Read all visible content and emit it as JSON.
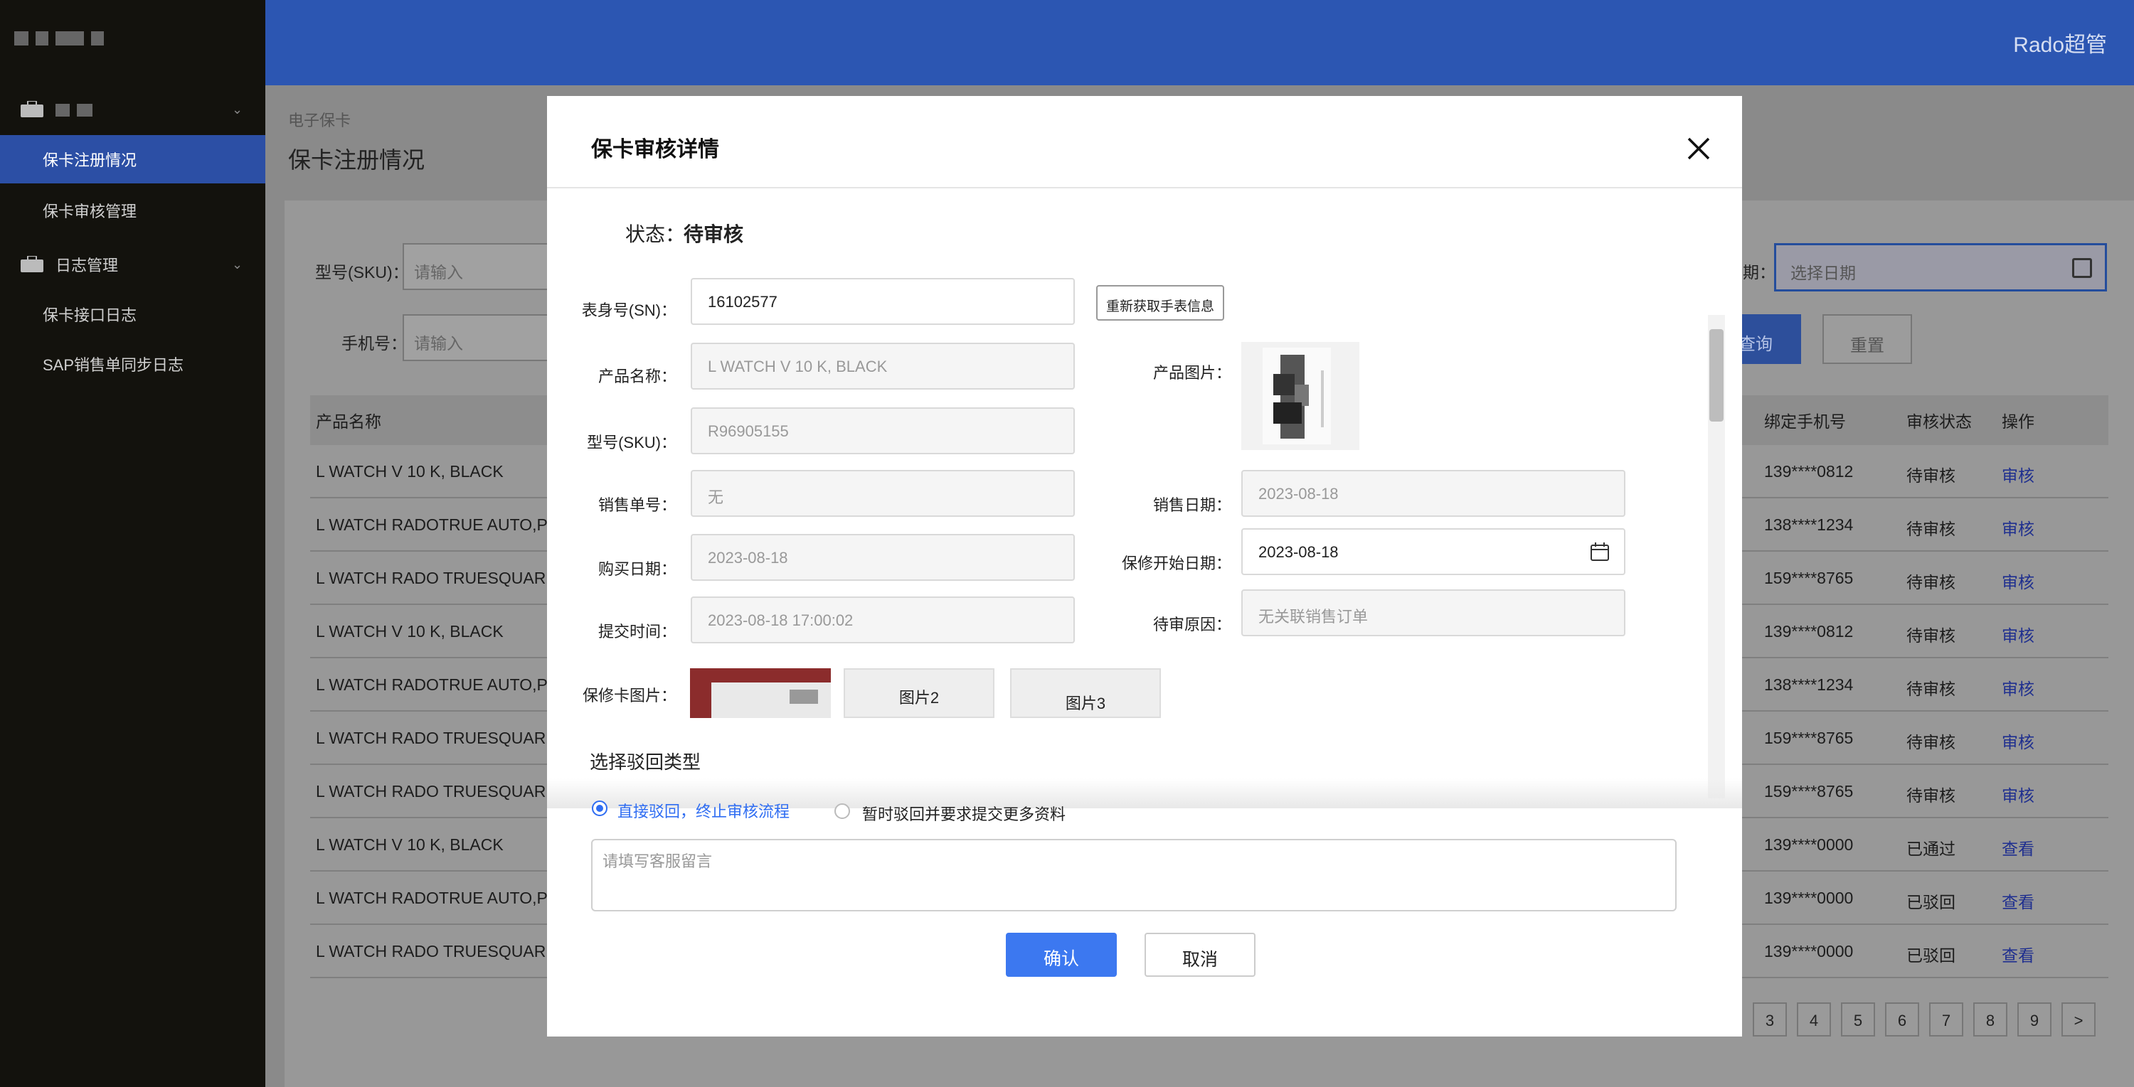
{
  "sidebar": {
    "groups": [
      {
        "label": ""
      },
      {
        "label": "日志管理"
      }
    ],
    "items": [
      {
        "label": "保卡注册情况"
      },
      {
        "label": "保卡审核管理"
      },
      {
        "label": "保卡接口日志"
      },
      {
        "label": "SAP销售单同步日志"
      }
    ]
  },
  "header": {
    "user": "Rado超管"
  },
  "breadcrumb": "电子保卡",
  "page_title": "保卡注册情况",
  "filters": {
    "sku_label": "型号(SKU)：",
    "sku_placeholder": "请输入",
    "phone_label": "手机号：",
    "phone_placeholder": "请输入",
    "date_label_tail": "期：",
    "date_placeholder": "选择日期",
    "query": "查询",
    "reset": "重置"
  },
  "table": {
    "headers": {
      "product": "产品名称",
      "phone": "绑定手机号",
      "status": "审核状态",
      "action": "操作"
    },
    "rows": [
      {
        "product": "L WATCH V 10 K, BLACK",
        "phone": "139****0812",
        "status": "待审核",
        "action": "审核"
      },
      {
        "product": "L WATCH RADOTRUE AUTO,PLA",
        "phone": "138****1234",
        "status": "待审核",
        "action": "审核"
      },
      {
        "product": "L WATCH RADO TRUESQUARE B",
        "phone": "159****8765",
        "status": "待审核",
        "action": "审核"
      },
      {
        "product": "L WATCH V 10 K, BLACK",
        "phone": "139****0812",
        "status": "待审核",
        "action": "审核"
      },
      {
        "product": "L WATCH RADOTRUE AUTO,PLA",
        "phone": "138****1234",
        "status": "待审核",
        "action": "审核"
      },
      {
        "product": "L WATCH RADO TRUESQUARE B",
        "phone": "159****8765",
        "status": "待审核",
        "action": "审核"
      },
      {
        "product": "L WATCH RADO TRUESQUARE B",
        "phone": "159****8765",
        "status": "待审核",
        "action": "审核"
      },
      {
        "product": "L WATCH V 10 K, BLACK",
        "phone": "139****0000",
        "status": "已通过",
        "action": "查看"
      },
      {
        "product": "L WATCH RADOTRUE AUTO,PLA",
        "phone": "139****0000",
        "status": "已驳回",
        "action": "查看"
      },
      {
        "product": "L WATCH RADO TRUESQUARE B",
        "phone": "139****0000",
        "status": "已驳回",
        "action": "查看"
      }
    ]
  },
  "pagination": {
    "pages": [
      "3",
      "4",
      "5",
      "6",
      "7",
      "8",
      "9"
    ],
    "next": ">"
  },
  "modal": {
    "title": "保卡审核详情",
    "status_label": "状态：",
    "status_value": "待审核",
    "sn_label": "表身号(SN)：",
    "sn_value": "16102577",
    "refetch": "重新获取手表信息",
    "product_name_label": "产品名称：",
    "product_name_value": "L WATCH V 10 K, BLACK",
    "product_image_label": "产品图片：",
    "sku_label": "型号(SKU)：",
    "sku_value": "R96905155",
    "sales_no_label": "销售单号：",
    "sales_no_value": "无",
    "sales_date_label": "销售日期：",
    "sales_date_value": "2023-08-18",
    "purchase_date_label": "购买日期：",
    "purchase_date_value": "2023-08-18",
    "warranty_start_label": "保修开始日期：",
    "warranty_start_value": "2023-08-18",
    "submit_time_label": "提交时间：",
    "submit_time_value": "2023-08-18 17:00:02",
    "pending_reason_label": "待审原因：",
    "pending_reason_value": "无关联销售订单",
    "card_images_label": "保修卡图片：",
    "image2": "图片2",
    "image3": "图片3",
    "reject_title": "选择驳回类型",
    "reject_option1": "直接驳回，终止审核流程",
    "reject_option2": "暂时驳回并要求提交更多资料",
    "message_placeholder": "请填写客服留言",
    "confirm": "确认",
    "cancel": "取消"
  },
  "colors": {
    "accent": "#3c78f0",
    "header": "#2c56b2",
    "sidebar": "#13120d"
  }
}
